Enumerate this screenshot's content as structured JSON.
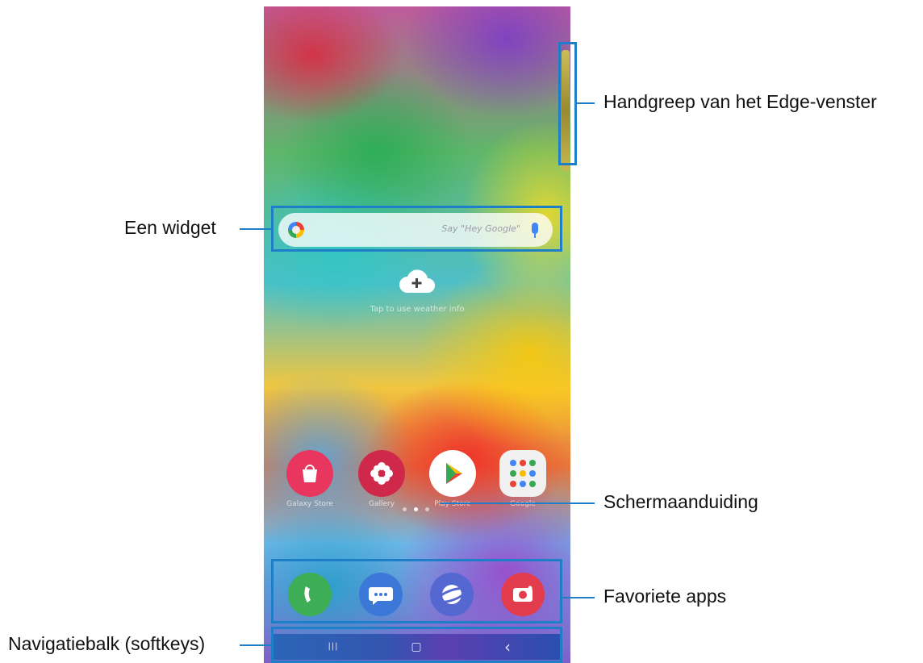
{
  "callouts": {
    "edge_handle": "Handgreep van het Edge-venster",
    "widget": "Een widget",
    "page_indicator": "Schermaanduiding",
    "favorite_apps": "Favoriete apps",
    "nav_bar": "Navigatiebalk (softkeys)"
  },
  "home": {
    "cloud_hint": "Tap to use weather info",
    "search_hint": "Say \"Hey Google\"",
    "apps": [
      {
        "label": "Galaxy Store",
        "icon": "shopping-bag-icon",
        "color": "#e8365e"
      },
      {
        "label": "Gallery",
        "icon": "flower-icon",
        "color": "#d0284a"
      },
      {
        "label": "Play Store",
        "icon": "play-store-icon",
        "color": "#ffffff"
      },
      {
        "label": "Google",
        "icon": "folder-icon",
        "color": "#f1f1f1"
      }
    ],
    "dock": [
      {
        "icon": "phone-icon",
        "color": "#3dae55"
      },
      {
        "icon": "messages-icon",
        "color": "#3c78d8"
      },
      {
        "icon": "internet-icon",
        "color": "#5567d0"
      },
      {
        "icon": "camera-icon",
        "color": "#e33c4c"
      }
    ],
    "nav": {
      "recents": "|||",
      "home": "▢",
      "back": "‹"
    }
  },
  "accent": "#1e7ec8"
}
